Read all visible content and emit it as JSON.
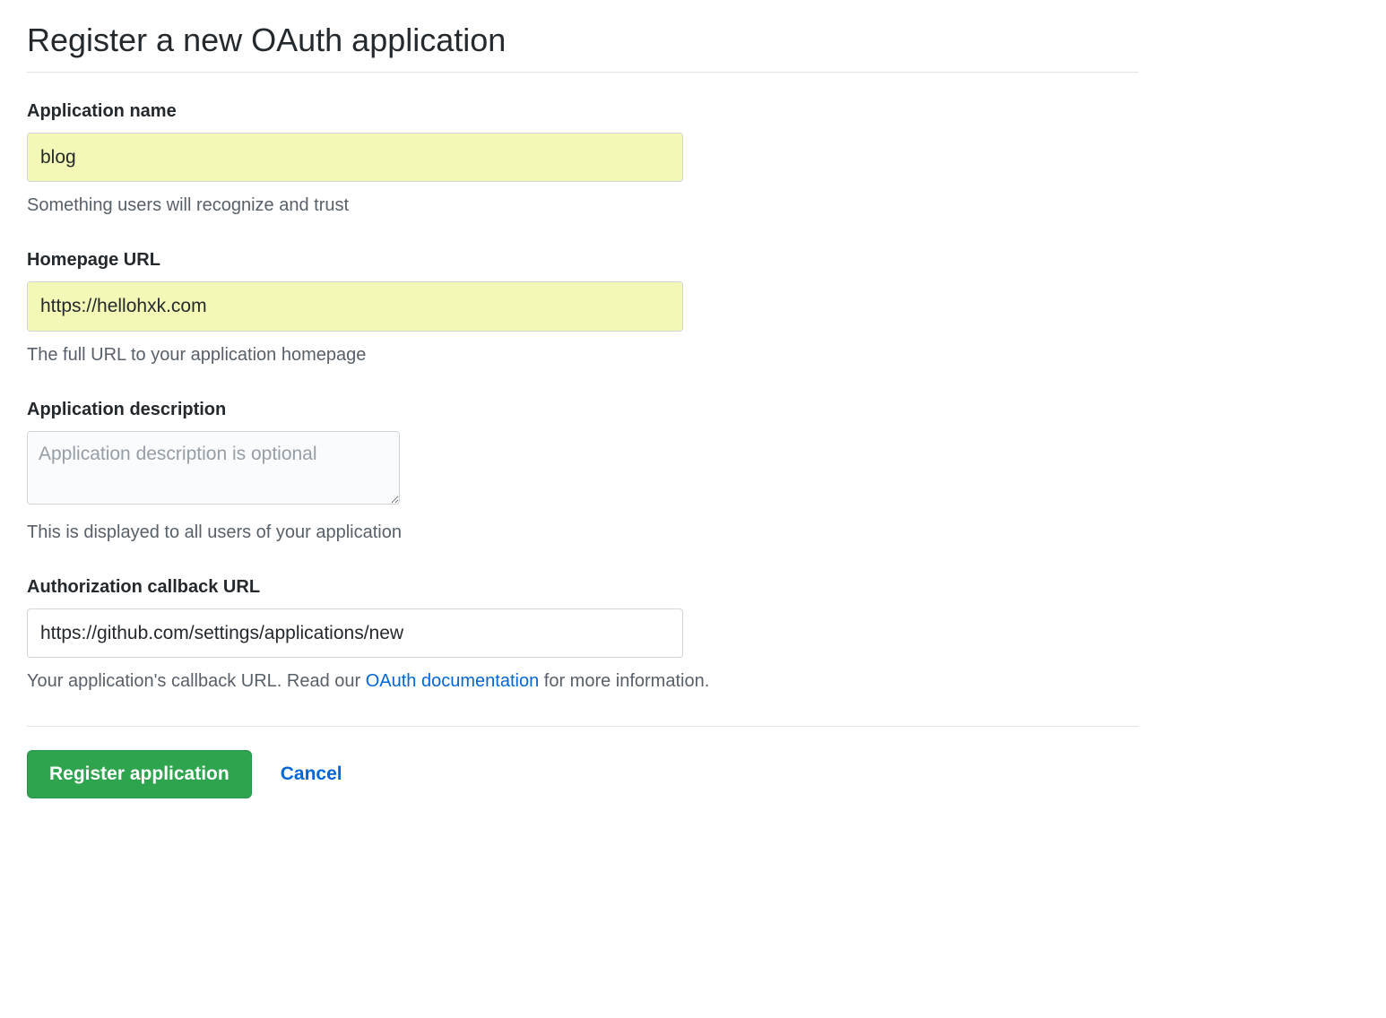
{
  "page": {
    "title": "Register a new OAuth application"
  },
  "form": {
    "app_name": {
      "label": "Application name",
      "value": "blog",
      "help": "Something users will recognize and trust"
    },
    "homepage_url": {
      "label": "Homepage URL",
      "value": "https://hellohxk.com",
      "help": "The full URL to your application homepage"
    },
    "description": {
      "label": "Application description",
      "value": "",
      "placeholder": "Application description is optional",
      "help": "This is displayed to all users of your application"
    },
    "callback_url": {
      "label": "Authorization callback URL",
      "value": "https://github.com/settings/applications/new",
      "help_prefix": "Your application's callback URL. Read our ",
      "help_link_text": "OAuth documentation",
      "help_suffix": " for more information."
    }
  },
  "actions": {
    "submit_label": "Register application",
    "cancel_label": "Cancel"
  }
}
